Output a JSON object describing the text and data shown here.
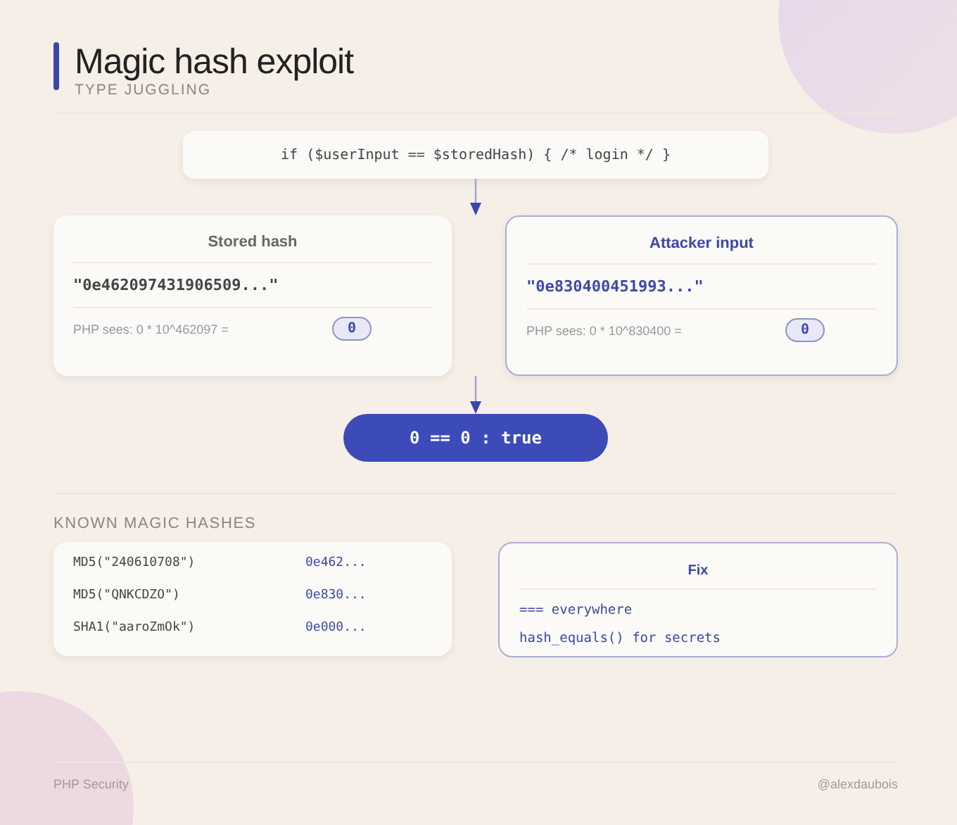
{
  "title": "Magic hash exploit",
  "subtitle": "TYPE JUGGLING",
  "code": "if ($userInput == $storedHash) { /* login */ }",
  "comparison": [
    {
      "kind": "stored",
      "title": "Stored hash",
      "hash": "\"0e462097431906509...\"",
      "explanation": "PHP sees: 0 * 10^462097 =",
      "result": "0"
    },
    {
      "kind": "attacker",
      "title": "Attacker input",
      "hash": "\"0e830400451993...\"",
      "explanation": "PHP sees: 0 * 10^830400 =",
      "result": "0"
    }
  ],
  "verdict": "0 == 0 : true",
  "known_hashes": {
    "heading": "KNOWN MAGIC HASHES",
    "rows": [
      {
        "input": "MD5(\"240610708\")",
        "hash": "0e462..."
      },
      {
        "input": "MD5(\"QNKCDZO\")",
        "hash": "0e830..."
      },
      {
        "input": "SHA1(\"aaroZmOk\")",
        "hash": "0e000..."
      }
    ]
  },
  "fix": {
    "title": "Fix",
    "lines": [
      "=== everywhere",
      "hash_equals() for secrets"
    ]
  },
  "footer": {
    "left": "PHP Security",
    "right": "@alexdaubois"
  }
}
